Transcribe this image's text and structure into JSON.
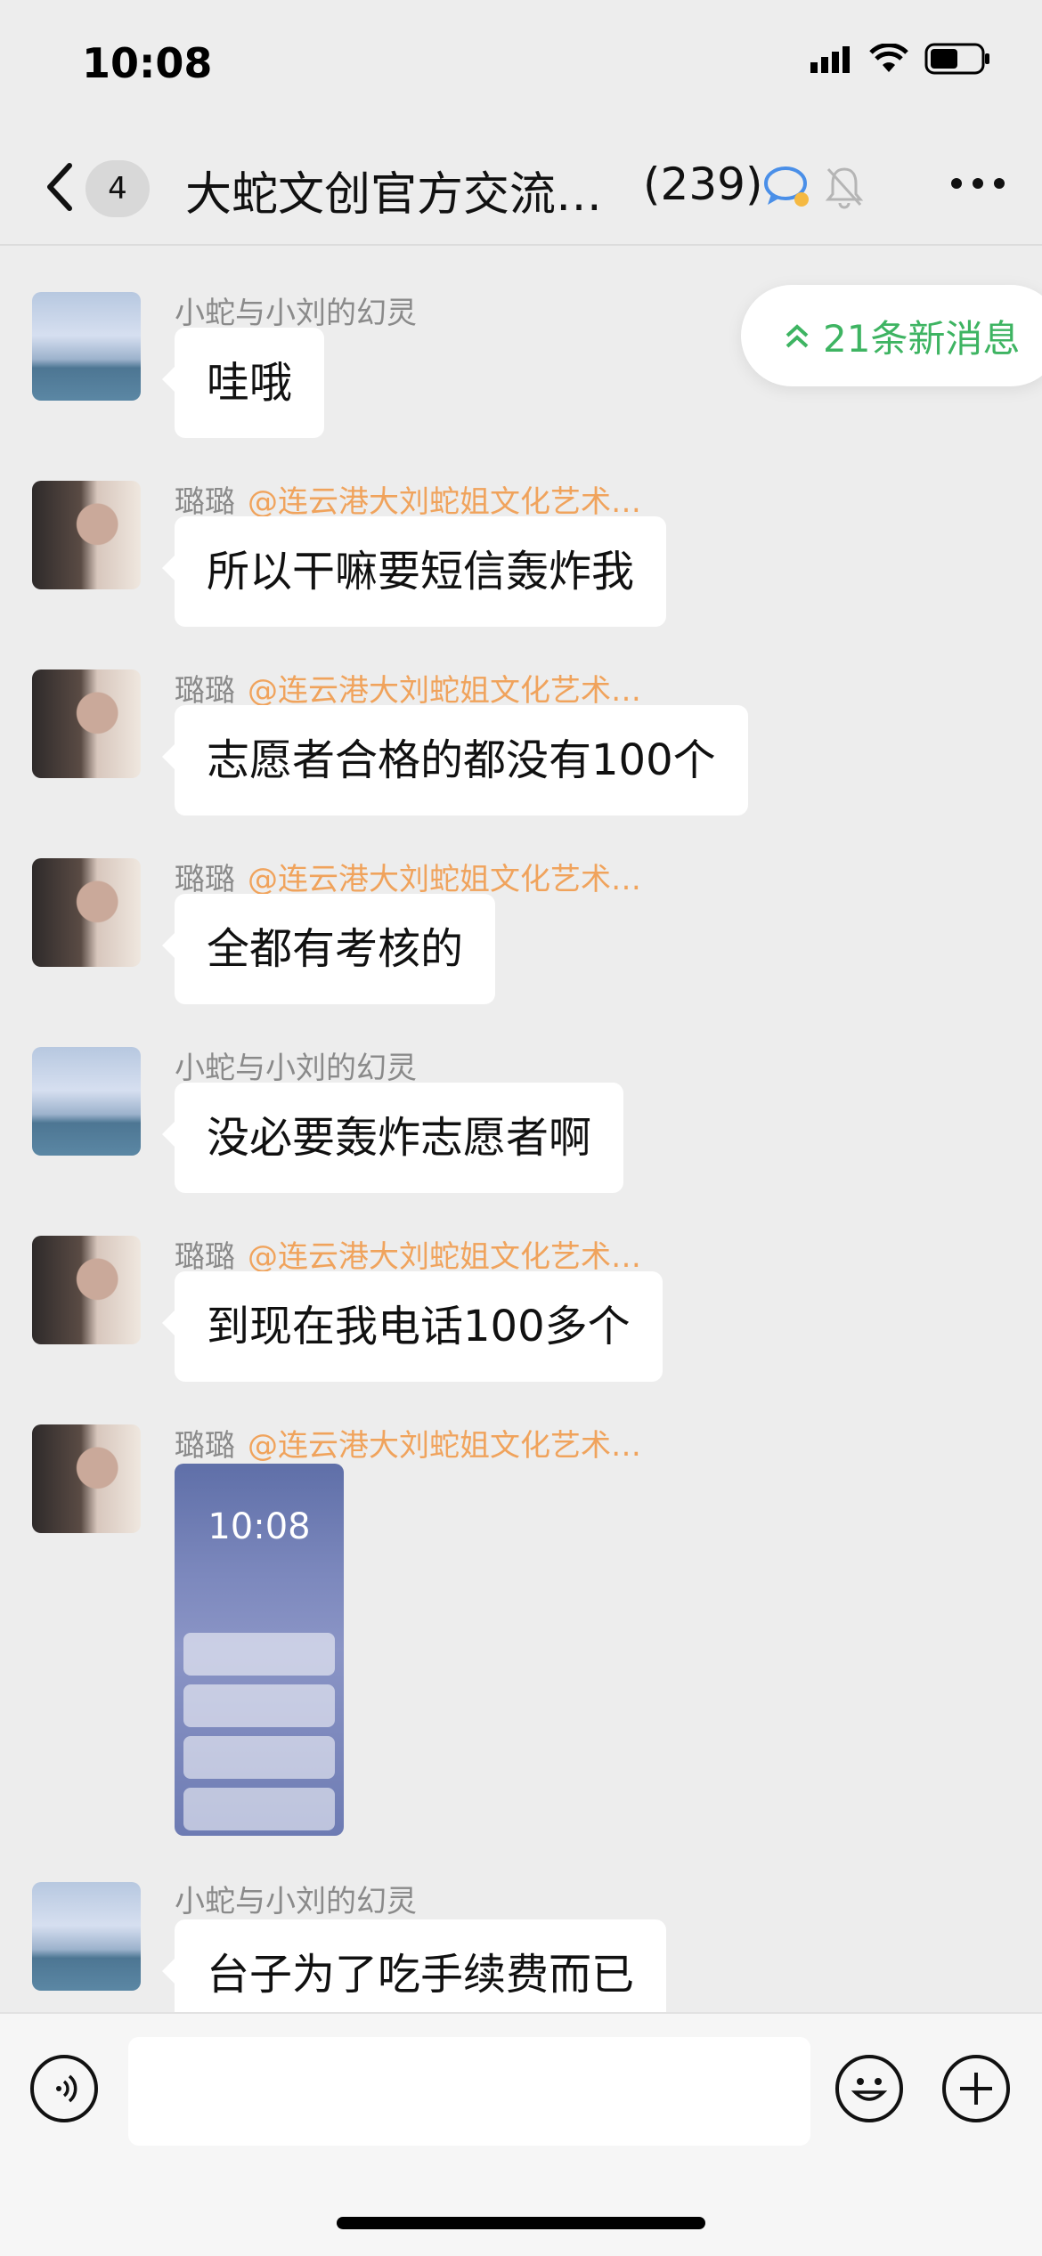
{
  "status": {
    "time": "10:08"
  },
  "nav": {
    "unread": "4",
    "title": "大蛇文创官方交流…",
    "member_count": "(239)"
  },
  "new_messages": {
    "label": "21条新消息"
  },
  "messages": [
    {
      "sender": "小蛇与小刘的幻灵",
      "mention": "",
      "text": "哇哦",
      "avatar": "sea"
    },
    {
      "sender": "璐璐",
      "mention": "@连云港大刘蛇姐文化艺术…",
      "text": "所以干嘛要短信轰炸我",
      "avatar": "girl"
    },
    {
      "sender": "璐璐",
      "mention": "@连云港大刘蛇姐文化艺术…",
      "text": "志愿者合格的都没有100个",
      "avatar": "girl"
    },
    {
      "sender": "璐璐",
      "mention": "@连云港大刘蛇姐文化艺术…",
      "text": "全都有考核的",
      "avatar": "girl"
    },
    {
      "sender": "小蛇与小刘的幻灵",
      "mention": "",
      "text": "没必要轰炸志愿者啊",
      "avatar": "sea"
    },
    {
      "sender": "璐璐",
      "mention": "@连云港大刘蛇姐文化艺术…",
      "text": "到现在我电话100多个",
      "avatar": "girl"
    },
    {
      "sender": "璐璐",
      "mention": "@连云港大刘蛇姐文化艺术…",
      "text": "",
      "avatar": "girl",
      "image_time": "10:08"
    },
    {
      "sender": "小蛇与小刘的幻灵",
      "mention": "",
      "text": "台子为了吃手续费而已",
      "avatar": "sea"
    }
  ],
  "input": {
    "placeholder": ""
  }
}
